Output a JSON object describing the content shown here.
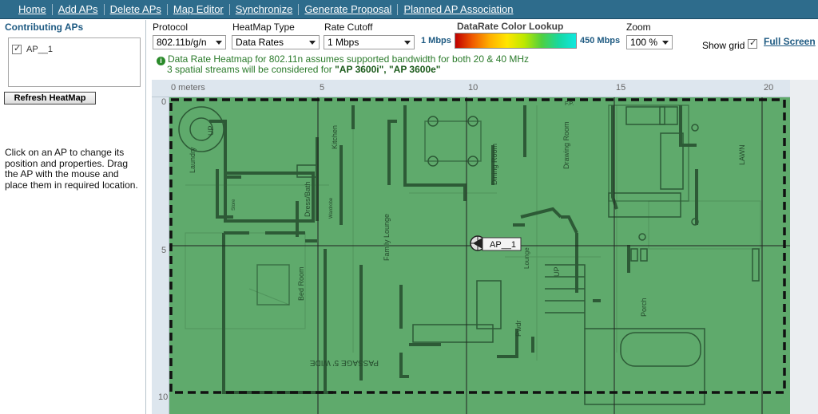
{
  "menu": [
    "Home",
    "Add APs",
    "Delete APs",
    "Map Editor",
    "Synchronize",
    "Generate Proposal",
    "Planned AP Association"
  ],
  "left_panel": {
    "title": "Contributing APs",
    "aps": [
      {
        "label": "AP__1",
        "checked": true
      }
    ],
    "refresh_label": "Refresh HeatMap",
    "help": "Click on an AP to change its position and properties. Drag the AP with the mouse and place them in required location."
  },
  "controls": {
    "protocol": {
      "label": "Protocol",
      "value": "802.11b/g/n"
    },
    "heatmap_type": {
      "label": "HeatMap Type",
      "value": "Data Rates"
    },
    "rate_cutoff": {
      "label": "Rate Cutoff",
      "value": "1 Mbps"
    },
    "color_lookup": {
      "title": "DataRate Color Lookup",
      "min": "1 Mbps",
      "max": "450 Mbps"
    },
    "zoom": {
      "label": "Zoom",
      "value": "100 %"
    },
    "show_grid": {
      "label": "Show grid",
      "checked": true
    },
    "full_screen": "Full Screen"
  },
  "notices": {
    "line1": "Data Rate Heatmap for 802.11n assumes supported bandwidth for both 20 & 40 MHz",
    "line2_prefix": "3 spatial streams will be considered for ",
    "line2_models": "\"AP 3600i\", \"AP 3600e\""
  },
  "ruler": {
    "x_ticks": [
      "0 meters",
      "5",
      "10",
      "15",
      "20"
    ],
    "y_ticks": [
      "0",
      "5",
      "10"
    ]
  },
  "map": {
    "heatmap_color": "#5faa6c",
    "ap_marker": {
      "label": "AP__1"
    },
    "room_labels": {
      "laundry": "Laundry",
      "up1": "UP",
      "kitchen": "Kitchen",
      "dress_bath": "Dress/Bath",
      "family_lounge": "Family Lounge",
      "dining_room": "Dining Room",
      "drawing_room": "Drawing Room",
      "lawn": "LAWN",
      "bed_room": "Bed Room",
      "powder": "Pwdr",
      "lounge": "Lounge",
      "up2": "UP",
      "porch": "Porch",
      "passage": "PASSAGE 5' WIDE",
      "store": "Store",
      "wardrobe": "Wardrobe",
      "fp": "F.P."
    }
  }
}
